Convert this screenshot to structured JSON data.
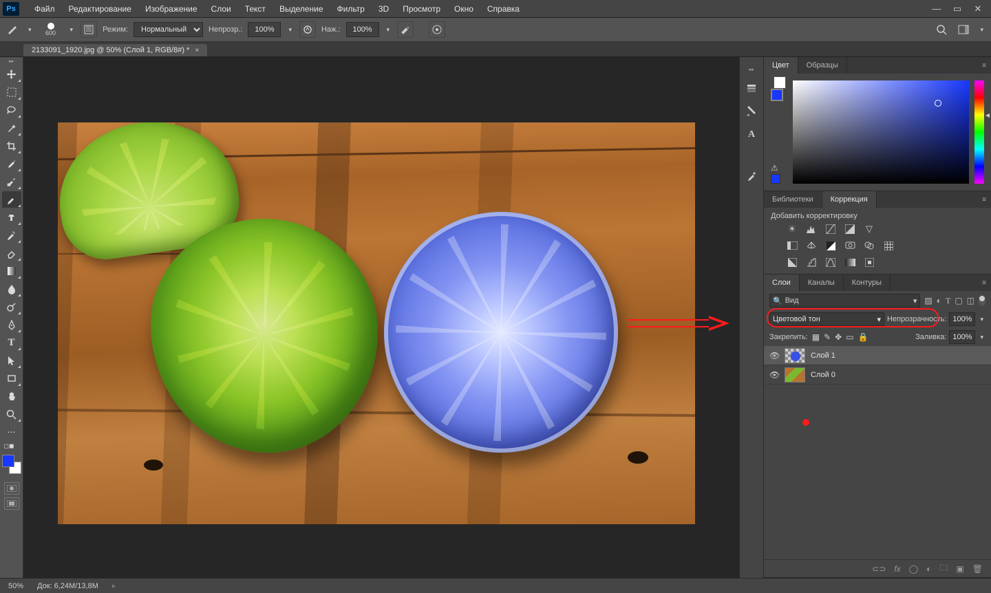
{
  "menu": {
    "items": [
      "Файл",
      "Редактирование",
      "Изображение",
      "Слои",
      "Текст",
      "Выделение",
      "Фильтр",
      "3D",
      "Просмотр",
      "Окно",
      "Справка"
    ]
  },
  "options": {
    "brush_size": "600",
    "mode_label": "Режим:",
    "mode_value": "Нормальный",
    "opacity_label": "Непрозр.:",
    "opacity_value": "100%",
    "flow_label": "Наж.:",
    "flow_value": "100%"
  },
  "tab": {
    "title": "2133091_1920.jpg @ 50% (Слой 1, RGB/8#) *",
    "close": "×"
  },
  "panels": {
    "color": {
      "tab1": "Цвет",
      "tab2": "Образцы"
    },
    "lib": {
      "tab1": "Библиотеки",
      "tab2": "Коррекция",
      "add_label": "Добавить корректировку"
    },
    "layers": {
      "tab1": "Слои",
      "tab2": "Каналы",
      "tab3": "Контуры",
      "search_kind": "Вид",
      "blend_mode": "Цветовой тон",
      "opacity_label": "Непрозрачность:",
      "opacity_value": "100%",
      "lock_label": "Закрепить:",
      "fill_label": "Заливка:",
      "fill_value": "100%",
      "items": [
        {
          "name": "Слой 1"
        },
        {
          "name": "Слой 0"
        }
      ]
    }
  },
  "status": {
    "zoom": "50%",
    "doc_label": "Док:",
    "doc_value": "6,24M/13,8M"
  }
}
